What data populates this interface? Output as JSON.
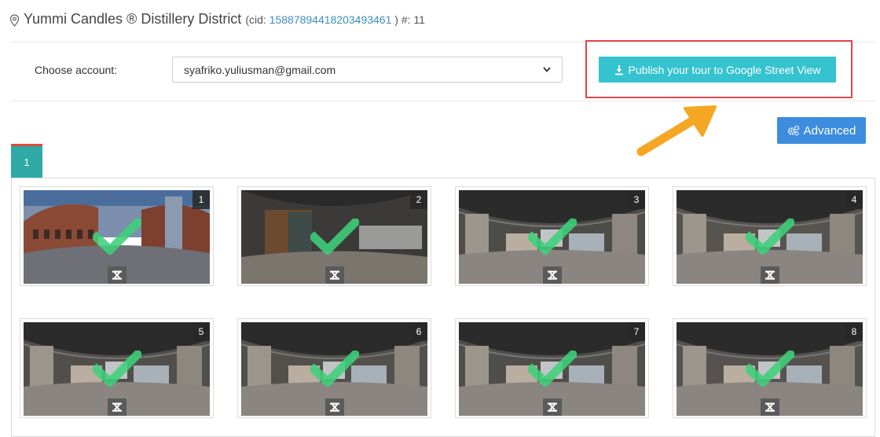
{
  "header": {
    "title": "Yummi Candles ® Distillery District",
    "cid_prefix": "(cid: ",
    "cid_value": "15887894418203493461",
    "cid_suffix": " ) #: 11"
  },
  "account": {
    "label": "Choose account:",
    "selected": "syafriko.yuliusman@gmail.com"
  },
  "publish": {
    "label": "Publish your tour to Google Street View"
  },
  "advanced": {
    "label": "Advanced"
  },
  "tabs": [
    {
      "label": "1"
    }
  ],
  "panoramas": [
    {
      "number": "1",
      "scene": "exterior"
    },
    {
      "number": "2",
      "scene": "storefront"
    },
    {
      "number": "3",
      "scene": "interior"
    },
    {
      "number": "4",
      "scene": "interior"
    },
    {
      "number": "5",
      "scene": "interior"
    },
    {
      "number": "6",
      "scene": "interior"
    },
    {
      "number": "7",
      "scene": "interior"
    },
    {
      "number": "8",
      "scene": "interior"
    }
  ],
  "colors": {
    "publish_button": "#34c3cf",
    "advanced_button": "#3c8dde",
    "tab": "#2fa9a5",
    "callout_border": "#e0474c",
    "arrow": "#f5a623",
    "check": "#3ed07a"
  }
}
